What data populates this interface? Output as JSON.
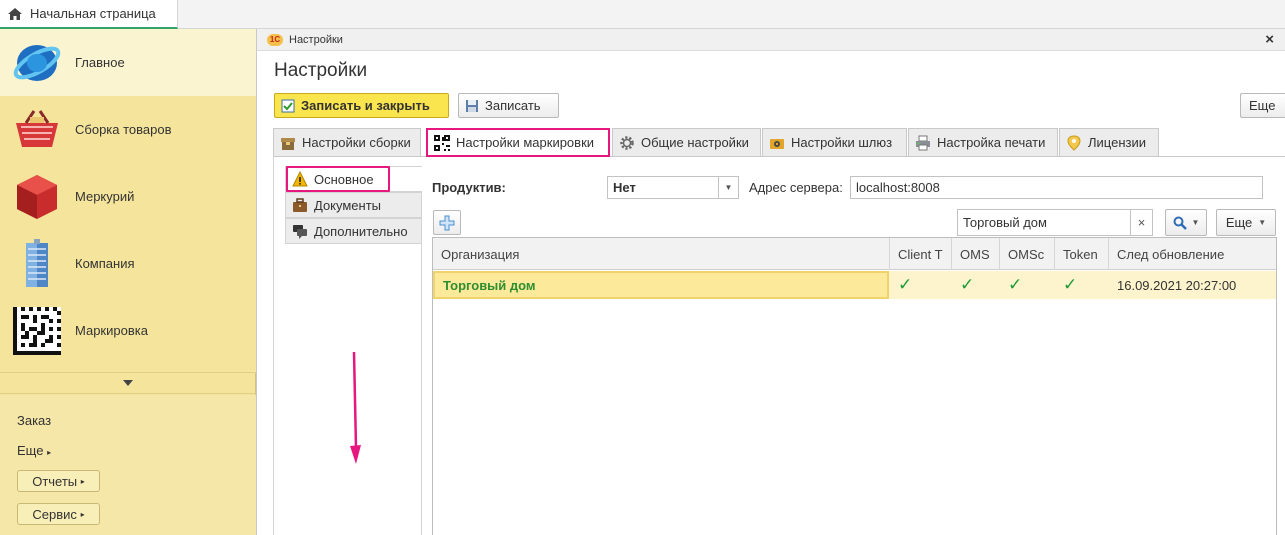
{
  "topbar": {
    "home_tab": "Начальная страница"
  },
  "left_panel": {
    "sections": [
      {
        "label": "Главное",
        "icon": "globe-icon"
      },
      {
        "label": "Сборка товаров",
        "icon": "basket-icon"
      },
      {
        "label": "Меркурий",
        "icon": "cube-icon"
      },
      {
        "label": "Компания",
        "icon": "building-icon"
      },
      {
        "label": "Маркировка",
        "icon": "datamatrix-icon"
      }
    ],
    "links": [
      "Заказ",
      "Еще"
    ],
    "buttons": [
      "Отчеты",
      "Сервис"
    ]
  },
  "window": {
    "title_bar": "Настройки",
    "form_title": "Настройки",
    "toolbar": {
      "save_close": "Записать и закрыть",
      "save": "Записать",
      "more": "Еще"
    },
    "tabs": [
      {
        "label": "Настройки сборки",
        "icon": "box-icon"
      },
      {
        "label": "Настройки маркировки",
        "icon": "qr-icon",
        "active": true
      },
      {
        "label": "Общие настройки",
        "icon": "gear-icon"
      },
      {
        "label": "Настройки шлюз",
        "icon": "gateway-icon"
      },
      {
        "label": "Настройка печати",
        "icon": "printer-icon"
      },
      {
        "label": "Лицензии",
        "icon": "license-icon"
      }
    ],
    "nav": [
      {
        "label": "Основное",
        "icon": "warning-icon",
        "active": true
      },
      {
        "label": "Документы",
        "icon": "briefcase-icon"
      },
      {
        "label": "Дополнительно",
        "icon": "chat-icon"
      }
    ],
    "fields": {
      "productive_label": "Продуктив:",
      "productive_value": "Нет",
      "server_label": "Адрес сервера:",
      "server_value": "localhost:8008",
      "search_value": "Торговый дом",
      "more": "Еще"
    },
    "table": {
      "columns": [
        "Организация",
        "Client T",
        "OMS",
        "OMSc",
        "Token",
        "След обновление"
      ],
      "rows": [
        {
          "org": "Торговый дом",
          "client_t": true,
          "oms": true,
          "omsc": true,
          "token": true,
          "next_update": "16.09.2021 20:27:00"
        }
      ]
    }
  },
  "colors": {
    "accent_yellow": "#fbe54f",
    "highlight_pink": "#e6177e",
    "panel_yellow": "#f5e59c",
    "check_green": "#1f9a3a"
  }
}
